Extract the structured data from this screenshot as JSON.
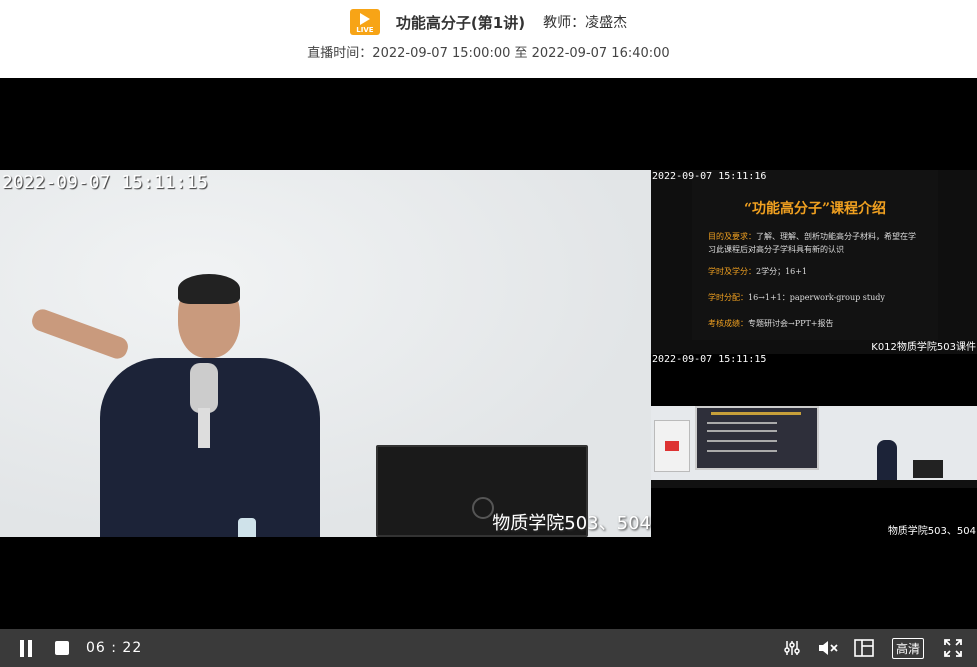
{
  "header": {
    "live_badge": "LIVE",
    "course_title": "功能高分子(第1讲)",
    "teacher": "教师：凌盛杰",
    "broadcast_time": "直播时间：2022-09-07 15:00:00 至 2022-09-07 16:40:00"
  },
  "main_video": {
    "timestamp": "2022-09-07  15:11:15",
    "location": "物质学院503、504"
  },
  "slide_video": {
    "timestamp": "2022-09-07 15:11:16",
    "slide_title": "“功能高分子”课程介绍",
    "line1_key": "目的及要求：",
    "line1_text": "了解、理解、剖析功能高分子材料，希望在学",
    "line2_text": "习此课程后对高分子学科具有新的认识",
    "line3_key": "学时及学分：",
    "line3_text": "2学分；16+1",
    "line4_key": "学时分配：",
    "line4_text": "16→1+1：paperwork-group study",
    "line5_key": "考核成绩：",
    "line5_text": "专题研讨会→PPT+报告",
    "room": "K012物质学院503课件"
  },
  "room_video": {
    "timestamp": "2022-09-07 15:11:15",
    "location": "物质学院503、504"
  },
  "controls": {
    "elapsed": "06 : 22",
    "quality": "高清"
  }
}
